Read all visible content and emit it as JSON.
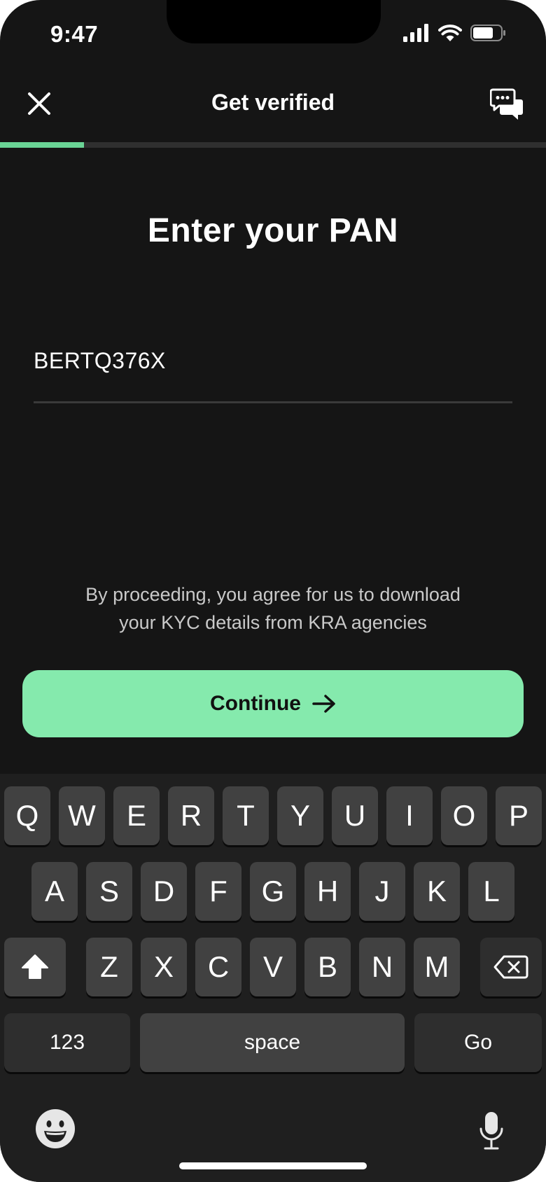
{
  "status_bar": {
    "time": "9:47"
  },
  "header": {
    "title": "Get verified"
  },
  "progress": {
    "fraction": 0.154
  },
  "main": {
    "title": "Enter your PAN"
  },
  "pan_field": {
    "value": "BERTQ376X",
    "placeholder": ""
  },
  "consent": {
    "line1": "By proceeding, you agree for us to download",
    "line2": "your KYC details from KRA agencies"
  },
  "continue_button": {
    "label": "Continue"
  },
  "keyboard": {
    "row1": [
      "Q",
      "W",
      "E",
      "R",
      "T",
      "Y",
      "U",
      "I",
      "O",
      "P"
    ],
    "row2": [
      "A",
      "S",
      "D",
      "F",
      "G",
      "H",
      "J",
      "K",
      "L"
    ],
    "row3": [
      "Z",
      "X",
      "C",
      "V",
      "B",
      "N",
      "M"
    ],
    "numbers_key": "123",
    "space_key": "space",
    "go_key": "Go"
  },
  "icons": {
    "close": "close-icon",
    "chat": "chat-icon",
    "continue_arrow": "arrow-right-icon",
    "shift": "shift-icon",
    "backspace": "backspace-icon",
    "emoji": "emoji-icon",
    "mic": "microphone-icon"
  },
  "colors": {
    "accent": "#85eaad",
    "progress": "#6ad495",
    "background": "#151515"
  }
}
